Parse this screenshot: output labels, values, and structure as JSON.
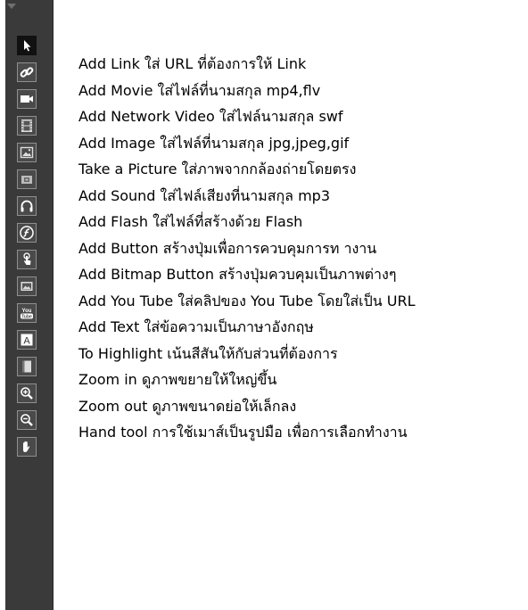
{
  "tools": [
    {
      "icon": "selection-arrow-icon",
      "label": "Add Link ใส่ URL ที่ต้องการให้ Link"
    },
    {
      "icon": "link-icon",
      "label": "Add Movie ใส่ไฟล์ที่นามสกุล mp4,flv"
    },
    {
      "icon": "video-camera-icon",
      "label": "Add Network Video ใส่ไฟล์นามสกุล swf"
    },
    {
      "icon": "film-strip-icon",
      "label": "Add Image ใส่ไฟล์ที่นามสกุล jpg,jpeg,gif"
    },
    {
      "icon": "image-icon",
      "label": "Take a Picture ใส่ภาพจากกล้องถ่ายโดยตรง"
    },
    {
      "icon": "camera-icon",
      "label": "Add Sound ใส่ไฟล์เสียงที่นามสกุล mp3"
    },
    {
      "icon": "headphones-icon",
      "label": "Add Flash ใส่ไฟล์ที่สร้างด้วย Flash"
    },
    {
      "icon": "flash-icon",
      "label": "Add Button สร้างปุ่มเพื่อการควบคุมการท างาน"
    },
    {
      "icon": "button-hand-icon",
      "label": "Add Bitmap Button สร้างปุ่มควบคุมเป็นภาพต่างๆ"
    },
    {
      "icon": "bitmap-button-icon",
      "label": "Add You Tube ใส่คลิปของ You Tube โดยใส่เป็น URL"
    },
    {
      "icon": "youtube-icon",
      "label": "Add Text ใส่ข้อความเป็นภาษาอังกฤษ"
    },
    {
      "icon": "text-icon",
      "label": "To Highlight เน้นสีสันให้กับส่วนที่ต้องการ"
    },
    {
      "icon": "highlight-icon",
      "label": "Zoom in ดูภาพขยายให้ใหญ่ขึ้น"
    },
    {
      "icon": "zoom-in-icon",
      "label": "Zoom out ดูภาพขนาดย่อให้เล็กลง"
    },
    {
      "icon": "zoom-out-icon",
      "label": "Hand tool การใช้เมาส์เป็นรูปมือ เพื่อการเลือกทำงาน"
    },
    {
      "icon": "hand-tool-icon",
      "label": ""
    }
  ],
  "youtube_icon_text": {
    "top": "You",
    "bottom": "Tube"
  },
  "text_icon_letter": "A"
}
